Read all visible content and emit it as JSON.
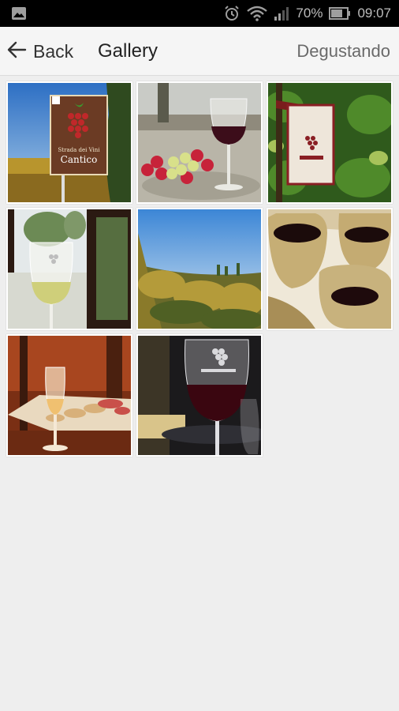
{
  "status_bar": {
    "battery": "70%",
    "time": "09:07",
    "icons": [
      "image-notification-icon",
      "alarm-icon",
      "wifi-icon",
      "signal-icon",
      "battery-icon"
    ]
  },
  "app_bar": {
    "back_label": "Back",
    "title": "Gallery",
    "action_label": "Degustando"
  },
  "sign_text": {
    "line1": "Strada dei Vini",
    "line2": "Cantico"
  },
  "gallery": {
    "photos": [
      "vineyard-sign-photo",
      "wine-glass-grapes-photo",
      "wine-bag-photo",
      "wine-glass-window-photo",
      "vineyard-rows-photo",
      "clay-jugs-photo",
      "wine-tasting-plate-photo",
      "red-wine-glass-photo"
    ]
  },
  "colors": {
    "status_bar_bg": "#000000",
    "app_bar_bg": "#f5f5f5",
    "page_bg": "#eeeeee",
    "sign_brown": "#6b3b24",
    "grape_red": "#c0282a"
  }
}
